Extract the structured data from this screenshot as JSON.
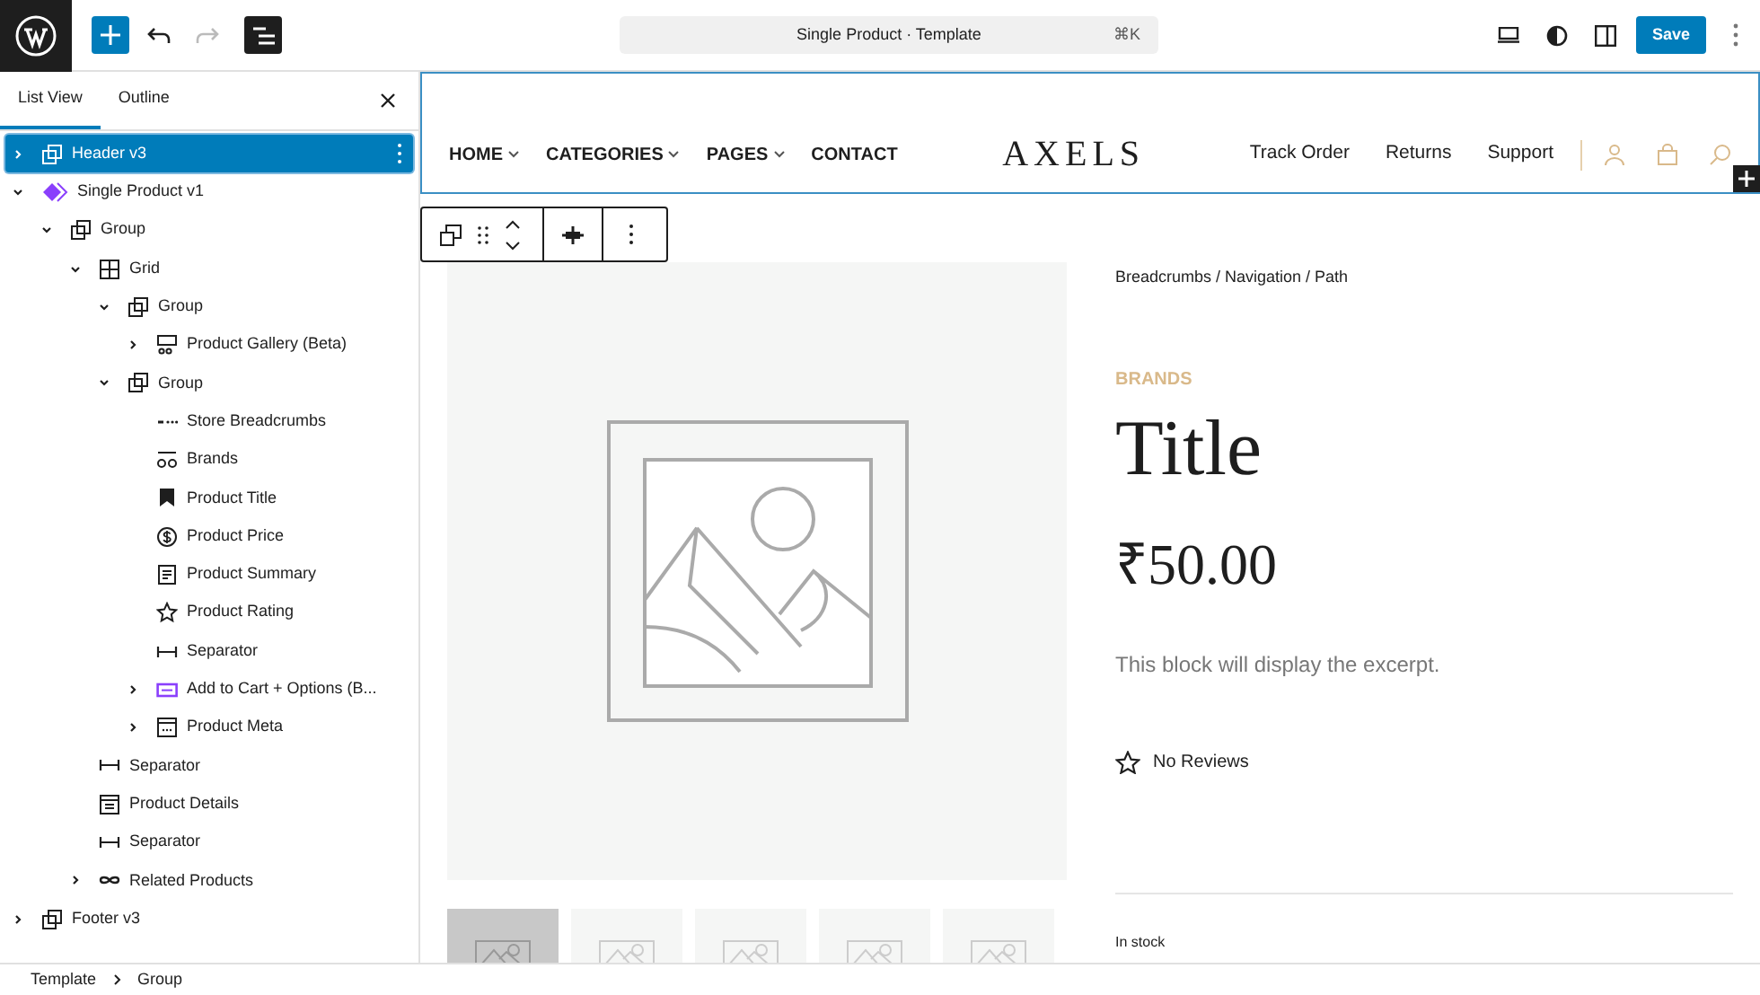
{
  "topbar": {
    "document_title": "Single Product · Template",
    "shortcut": "⌘K",
    "save": "Save"
  },
  "sidebar": {
    "tabs": [
      {
        "label": "List View",
        "selected": true
      },
      {
        "label": "Outline",
        "selected": false
      }
    ],
    "tree": [
      {
        "label": "Header v3",
        "kind": "group",
        "expanded": false,
        "selected": true
      },
      {
        "label": "Single Product v1",
        "kind": "pattern",
        "expanded": true,
        "selected": false,
        "children": [
          {
            "label": "Group",
            "kind": "group",
            "expanded": true,
            "selected": false,
            "children": [
              {
                "label": "Grid",
                "kind": "grid",
                "expanded": true,
                "selected": false,
                "children": [
                  {
                    "label": "Group",
                    "kind": "group",
                    "expanded": true,
                    "selected": false,
                    "children": [
                      {
                        "label": "Product Gallery (Beta)",
                        "kind": "gallery",
                        "expanded": false,
                        "selected": false
                      }
                    ]
                  },
                  {
                    "label": "Group",
                    "kind": "group",
                    "expanded": true,
                    "selected": false,
                    "children": [
                      {
                        "label": "Store Breadcrumbs",
                        "kind": "breadcrumbs",
                        "selected": false
                      },
                      {
                        "label": "Brands",
                        "kind": "brands",
                        "selected": false
                      },
                      {
                        "label": "Product Title",
                        "kind": "bookmark",
                        "selected": false
                      },
                      {
                        "label": "Product Price",
                        "kind": "price",
                        "selected": false
                      },
                      {
                        "label": "Product Summary",
                        "kind": "summary",
                        "selected": false
                      },
                      {
                        "label": "Product Rating",
                        "kind": "star",
                        "selected": false
                      },
                      {
                        "label": "Separator",
                        "kind": "separator",
                        "selected": false
                      },
                      {
                        "label": "Add to Cart + Options (B...",
                        "kind": "cart",
                        "expanded": false,
                        "selected": false
                      },
                      {
                        "label": "Product Meta",
                        "kind": "meta",
                        "expanded": false,
                        "selected": false
                      }
                    ]
                  }
                ]
              },
              {
                "label": "Separator",
                "kind": "separator",
                "selected": false
              },
              {
                "label": "Product Details",
                "kind": "details",
                "selected": false
              },
              {
                "label": "Separator",
                "kind": "separator",
                "selected": false
              },
              {
                "label": "Related Products",
                "kind": "loop",
                "expanded": false,
                "selected": false
              }
            ]
          }
        ]
      },
      {
        "label": "Footer v3",
        "kind": "group",
        "expanded": false,
        "selected": false
      }
    ]
  },
  "canvas": {
    "header": {
      "nav": [
        {
          "label": "HOME",
          "dropdown": true
        },
        {
          "label": "CATEGORIES",
          "dropdown": true
        },
        {
          "label": "PAGES",
          "dropdown": true
        },
        {
          "label": "CONTACT",
          "dropdown": false
        }
      ],
      "logo": "AXELS",
      "links": [
        "Track Order",
        "Returns",
        "Support"
      ]
    },
    "gallery": {
      "thumbnails": [
        {
          "selected": true
        },
        {
          "selected": false
        },
        {
          "selected": false
        },
        {
          "selected": false
        },
        {
          "selected": false
        }
      ]
    },
    "product": {
      "breadcrumbs": "Breadcrumbs / Navigation / Path",
      "brand": "BRANDS",
      "title": "Title",
      "price": "₹50.00",
      "excerpt": "This block will display the excerpt.",
      "rating": "No Reviews",
      "stock": "In stock"
    }
  },
  "breadcrumb_bar": [
    "Template",
    "Group"
  ]
}
